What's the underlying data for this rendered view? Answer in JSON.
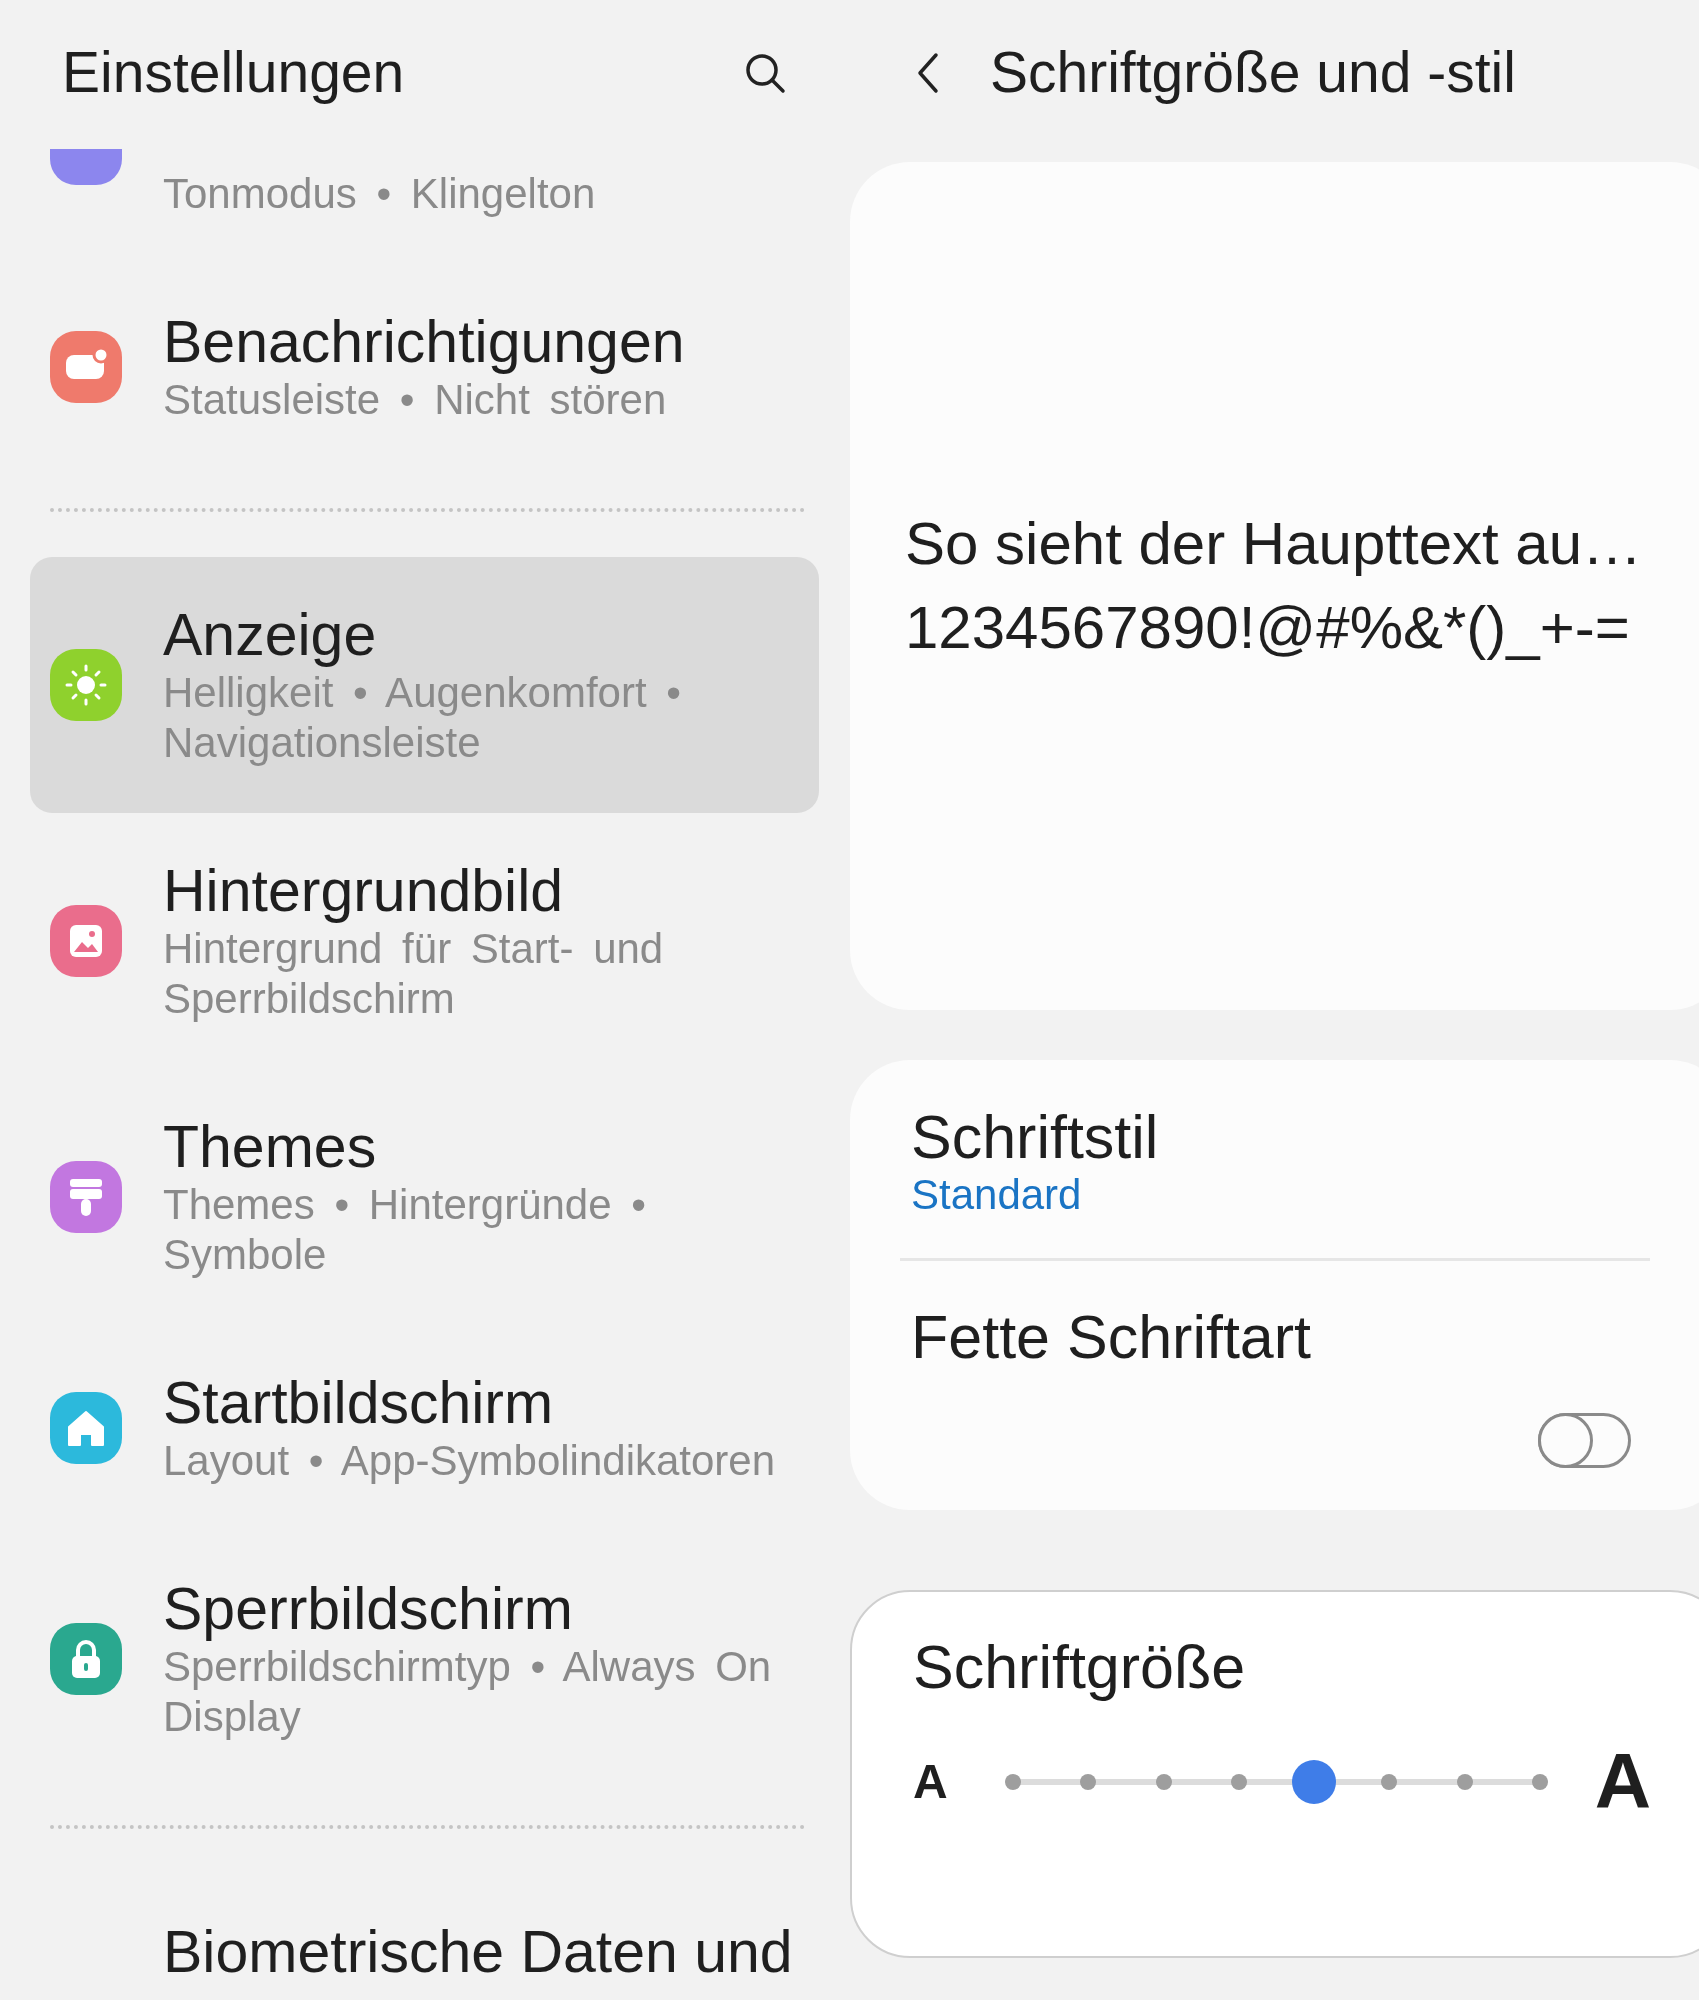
{
  "left": {
    "title": "Einstellungen",
    "items": [
      {
        "kind": "sound",
        "color": "#8c86ee",
        "subtitle": "Tonmodus • Klingelton",
        "selected": false
      },
      {
        "kind": "notification",
        "color": "#ef7a6c",
        "title": "Benachrichtigungen",
        "subtitle": "Statusleiste • Nicht stören",
        "selected": false
      },
      {
        "kind": "divider"
      },
      {
        "kind": "display",
        "color": "#8fd12d",
        "title": "Anzeige",
        "subtitle": "Helligkeit • Augenkomfort • Navigationsleiste",
        "selected": true
      },
      {
        "kind": "wallpaper",
        "color": "#ea6d8c",
        "title": "Hintergrundbild",
        "subtitle": "Hintergrund für Start- und Sperrbildschirm",
        "selected": false
      },
      {
        "kind": "themes",
        "color": "#c277e0",
        "title": "Themes",
        "subtitle": "Themes • Hintergründe • Symbole",
        "selected": false
      },
      {
        "kind": "home",
        "color": "#2cb9dc",
        "title": "Startbildschirm",
        "subtitle": "Layout • App-Symbolindikatoren",
        "selected": false
      },
      {
        "kind": "lock",
        "color": "#2aa88f",
        "title": "Sperrbildschirm",
        "subtitle": "Sperrbildschirmtyp • Always On Display",
        "selected": false
      },
      {
        "kind": "divider"
      },
      {
        "kind": "plain",
        "title": "Biometrische Daten und",
        "selected": false
      }
    ]
  },
  "right": {
    "title": "Schriftgröße und -stil",
    "preview": [
      "So sieht der Haupttext au…",
      "1234567890!@#%&*()_+-="
    ],
    "font_style": {
      "label": "Schriftstil",
      "value": "Standard"
    },
    "bold_font": {
      "label": "Fette Schriftart",
      "on": false
    },
    "font_size": {
      "label": "Schriftgröße",
      "small_label": "A",
      "large_label": "A",
      "level": 0.5714
    }
  }
}
